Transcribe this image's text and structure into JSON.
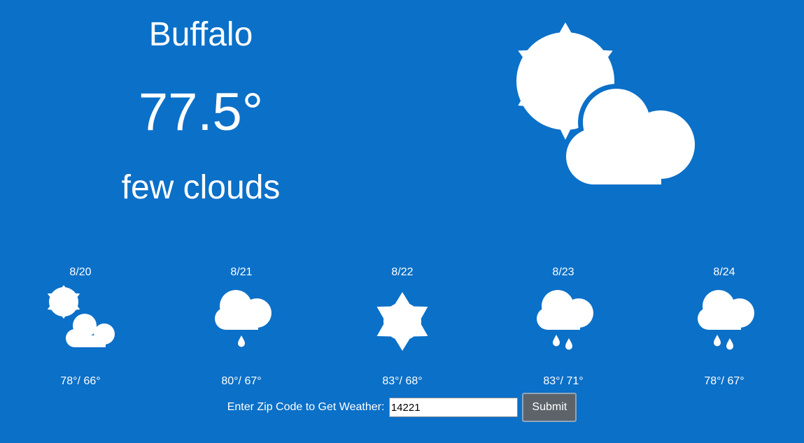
{
  "current": {
    "city": "Buffalo",
    "temperature": "77.5°",
    "description": "few clouds",
    "icon": "sun-behind-cloud-icon"
  },
  "forecast": [
    {
      "date": "8/20",
      "hilo": "78°/ 66°",
      "icon": "sun-behind-cloud-icon"
    },
    {
      "date": "8/21",
      "hilo": "80°/ 67°",
      "icon": "cloud-light-rain-icon"
    },
    {
      "date": "8/22",
      "hilo": "83°/ 68°",
      "icon": "sun-icon"
    },
    {
      "date": "8/23",
      "hilo": "83°/ 71°",
      "icon": "cloud-rain-icon"
    },
    {
      "date": "8/24",
      "hilo": "78°/ 67°",
      "icon": "cloud-rain-icon"
    }
  ],
  "zip_form": {
    "label": "Enter Zip Code to Get Weather:",
    "value": "14221",
    "submit_label": "Submit"
  },
  "colors": {
    "background": "#0b70c8",
    "text": "#ffffff",
    "submit_button": "#5d6369"
  }
}
